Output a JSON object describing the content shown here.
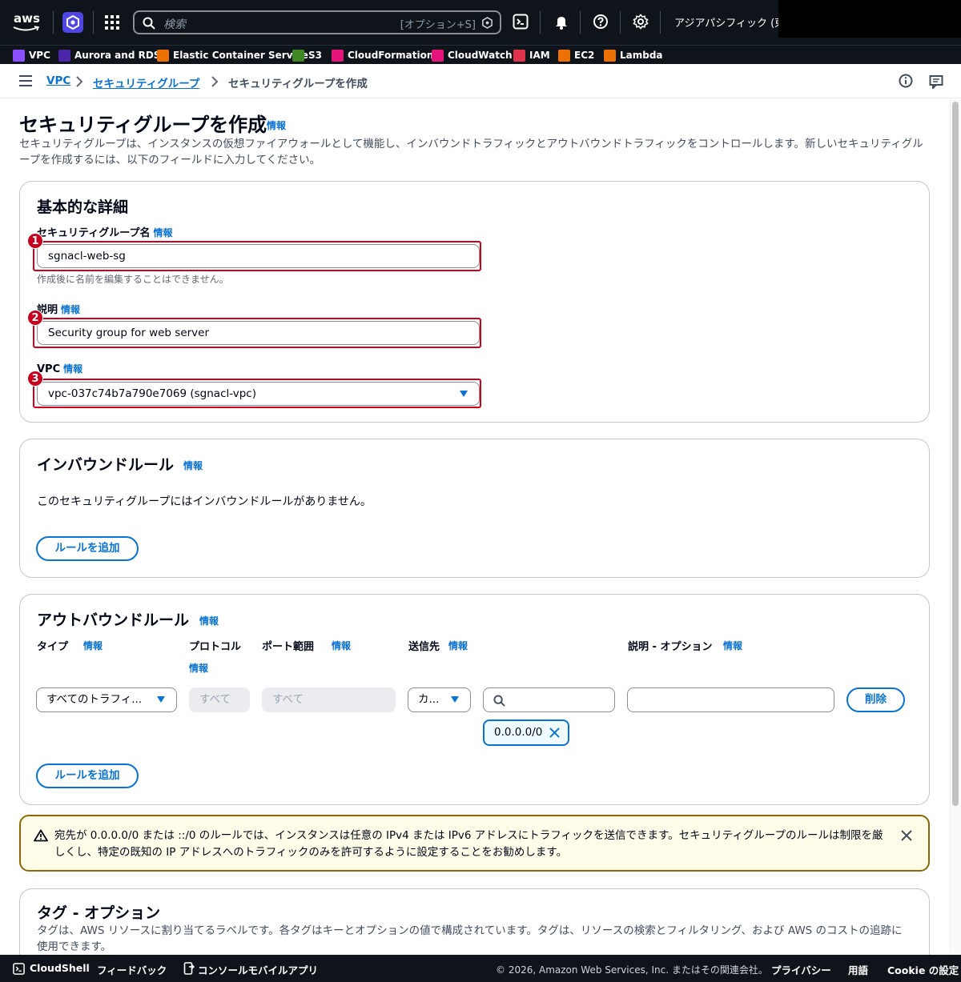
{
  "topnav": {
    "logo_text": "aws",
    "search_placeholder": "検索",
    "search_shortcut": "[オプション+S]",
    "region": "アジアパシフィック (東京)"
  },
  "favorites": [
    {
      "label": "VPC",
      "color": "#8c4fff"
    },
    {
      "label": "Aurora and RDS",
      "color": "#4d27aa"
    },
    {
      "label": "Elastic Container Service",
      "color": "#ed7100"
    },
    {
      "label": "S3",
      "color": "#3f8624"
    },
    {
      "label": "CloudFormation",
      "color": "#e7157b"
    },
    {
      "label": "CloudWatch",
      "color": "#e7157b"
    },
    {
      "label": "IAM",
      "color": "#dd344c"
    },
    {
      "label": "EC2",
      "color": "#ed7100"
    },
    {
      "label": "Lambda",
      "color": "#ed7100"
    }
  ],
  "breadcrumb": {
    "items": [
      "VPC",
      "セキュリティグループ",
      "セキュリティグループを作成"
    ]
  },
  "header": {
    "title": "セキュリティグループを作成",
    "info": "情報",
    "description": "セキュリティグループは、インスタンスの仮想ファイアウォールとして機能し、インバウンドトラフィックとアウトバウンドトラフィックをコントロールします。新しいセキュリティグループを作成するには、以下のフィールドに入力してください。"
  },
  "basic": {
    "title": "基本的な詳細",
    "name_label": "セキュリティグループ名",
    "name_value": "sgnacl-web-sg",
    "name_hint": "作成後に名前を編集することはできません。",
    "desc_label": "説明",
    "desc_value": "Security group for web server",
    "vpc_label": "VPC",
    "vpc_value": "vpc-037c74b7a790e7069 (sgnacl-vpc)",
    "info": "情報",
    "badges": [
      "1",
      "2",
      "3"
    ]
  },
  "inbound": {
    "title": "インバウンドルール",
    "info": "情報",
    "empty_text": "このセキュリティグループにはインバウンドルールがありません。",
    "add_button": "ルールを追加"
  },
  "outbound": {
    "title": "アウトバウンドルール",
    "info": "情報",
    "columns": {
      "type": "タイプ",
      "protocol": "プロトコル",
      "port": "ポート範囲",
      "destination": "送信先",
      "description": "説明 - オプション"
    },
    "row": {
      "type": "すべてのトラフィ...",
      "protocol": "すべて",
      "port": "すべて",
      "destination_type": "カ...",
      "cidr_token": "0.0.0.0/0",
      "description": ""
    },
    "delete_button": "削除",
    "add_button": "ルールを追加"
  },
  "alert": {
    "text": "宛先が 0.0.0.0/0 または ::/0 のルールでは、インスタンスは任意の IPv4 または IPv6 アドレスにトラフィックを送信できます。セキュリティグループのルールは制限を厳しくし、特定の既知の IP アドレスへのトラフィックのみを許可するように設定することをお勧めします。"
  },
  "tags": {
    "title": "タグ - オプション",
    "description": "タグは、AWS リソースに割り当てるラベルです。各タグはキーとオプションの値で構成されています。タグは、リソースの検索とフィルタリング、および AWS のコストの追跡に使用できます。"
  },
  "footer": {
    "cloudshell": "CloudShell",
    "feedback": "フィードバック",
    "mobile": "コンソールモバイルアプリ",
    "copyright": "© 2026, Amazon Web Services, Inc. またはその関連会社。",
    "privacy": "プライバシー",
    "terms": "用語",
    "cookie": "Cookie の設定"
  }
}
